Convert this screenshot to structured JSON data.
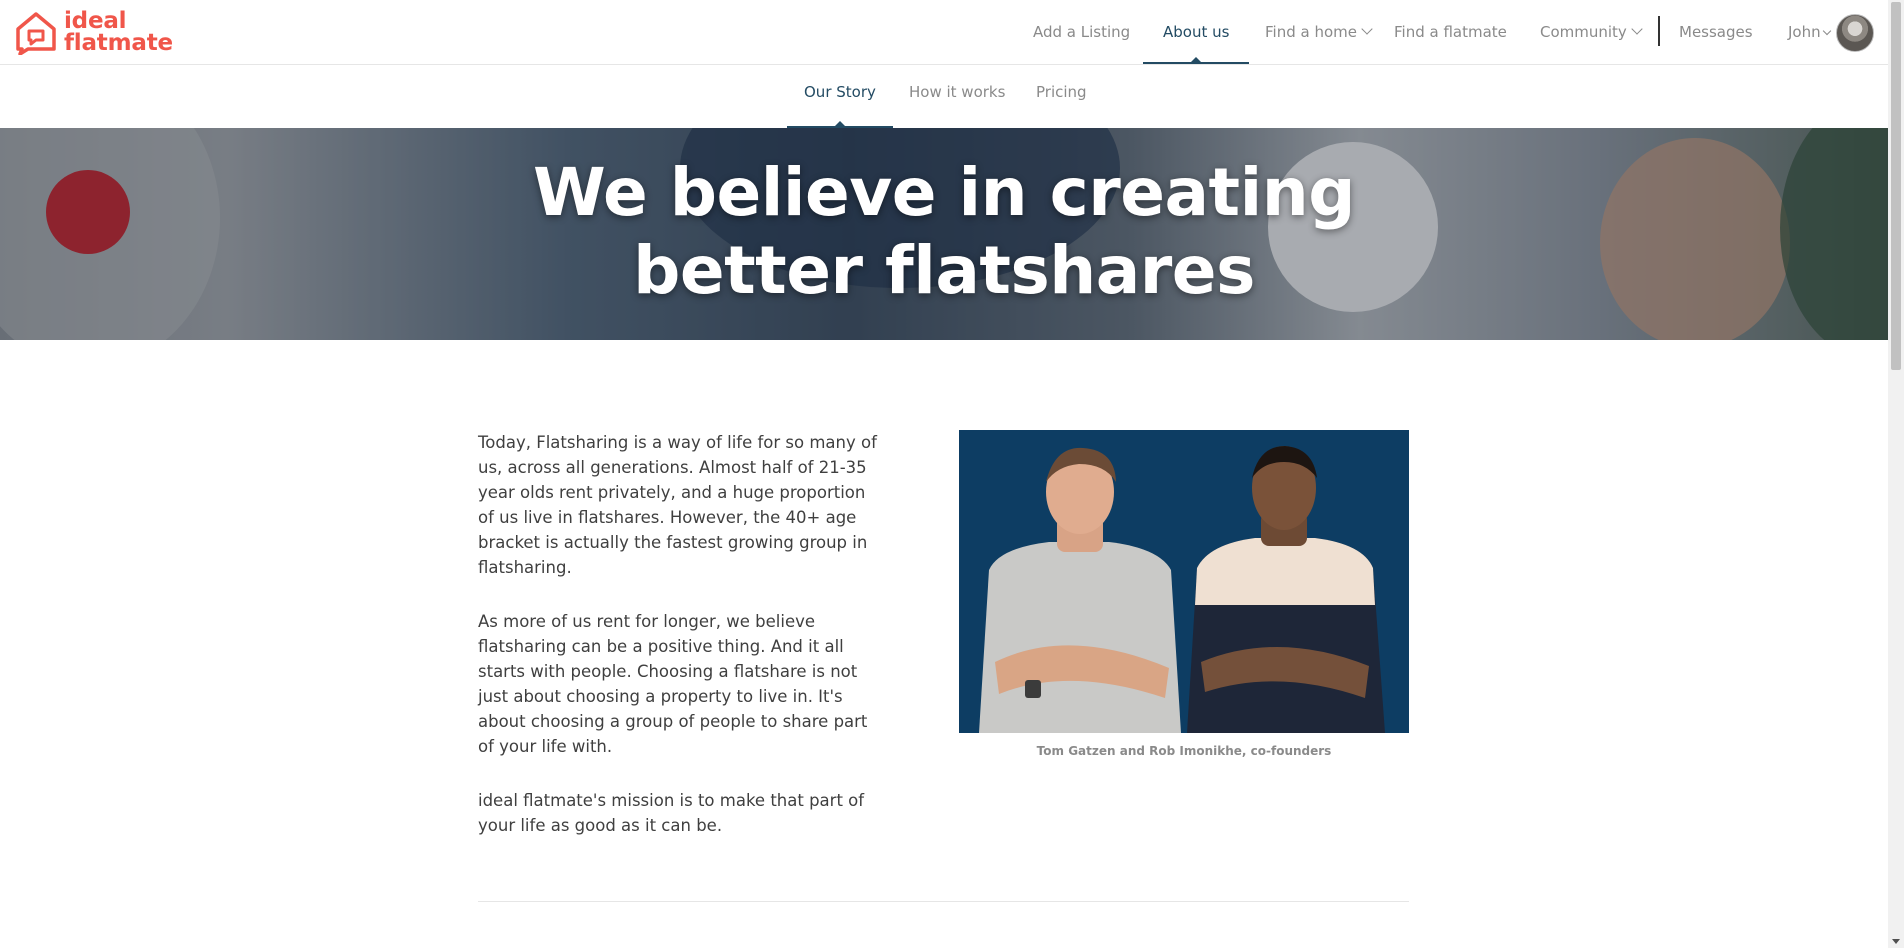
{
  "brand": {
    "line1": "ideal",
    "line2": "flatmate",
    "color": "#f0564a"
  },
  "nav": {
    "add_listing": "Add a Listing",
    "about_us": "About us",
    "find_home": "Find a home",
    "find_flatmate": "Find a flatmate",
    "community": "Community",
    "messages": "Messages",
    "user_name": "John"
  },
  "subnav": {
    "our_story": "Our Story",
    "how_it_works": "How it works",
    "pricing": "Pricing"
  },
  "hero": {
    "line1": "We believe in creating",
    "line2": "better flatshares"
  },
  "story": {
    "p1": "Today, Flatsharing is a way of life for so many of us, across all generations. Almost half of 21-35 year olds rent privately, and a huge proportion of us live in flatshares. However, the 40+ age bracket is actually the fastest growing group in flatsharing.",
    "p2": "As more of us rent for longer, we believe flatsharing can be a positive thing. And it all starts with people. Choosing a flatshare is not just about choosing a property to live in. It's about choosing a group of people to share part of your life with.",
    "p3": "ideal flatmate's mission is to make that part of your life as good as it can be."
  },
  "photo": {
    "caption": "Tom Gatzen and Rob Imonikhe, co-founders"
  },
  "colors": {
    "accent": "#234b63",
    "photo_bg": "#0d3d63"
  }
}
